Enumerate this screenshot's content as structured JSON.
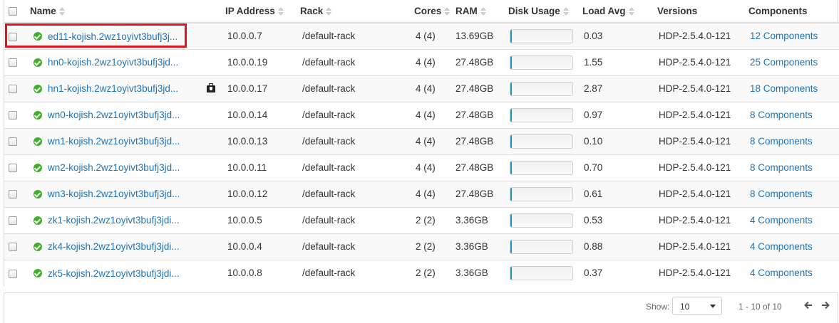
{
  "columns": {
    "name": "Name",
    "ip": "IP Address",
    "rack": "Rack",
    "cores": "Cores",
    "ram": "RAM",
    "disk": "Disk Usage",
    "load": "Load Avg",
    "versions": "Versions",
    "components": "Components"
  },
  "hosts": [
    {
      "name": "ed11-kojish.2wz1oyivt3bufj3j...",
      "ip": "10.0.0.7",
      "rack": "/default-rack",
      "cores": "4 (4)",
      "ram": "13.69GB",
      "disk_fraction": 0.02,
      "load": "0.03",
      "version": "HDP-2.5.4.0-121",
      "components": "12 Components",
      "maintenance": false
    },
    {
      "name": "hn0-kojish.2wz1oyivt3bufj3jd...",
      "ip": "10.0.0.19",
      "rack": "/default-rack",
      "cores": "4 (4)",
      "ram": "27.48GB",
      "disk_fraction": 0.02,
      "load": "1.55",
      "version": "HDP-2.5.4.0-121",
      "components": "25 Components",
      "maintenance": false
    },
    {
      "name": "hn1-kojish.2wz1oyivt3bufj3jd...",
      "ip": "10.0.0.17",
      "rack": "/default-rack",
      "cores": "4 (4)",
      "ram": "27.48GB",
      "disk_fraction": 0.02,
      "load": "2.87",
      "version": "HDP-2.5.4.0-121",
      "components": "18 Components",
      "maintenance": true
    },
    {
      "name": "wn0-kojish.2wz1oyivt3bufj3jd...",
      "ip": "10.0.0.14",
      "rack": "/default-rack",
      "cores": "4 (4)",
      "ram": "27.48GB",
      "disk_fraction": 0.02,
      "load": "0.97",
      "version": "HDP-2.5.4.0-121",
      "components": "8 Components",
      "maintenance": false
    },
    {
      "name": "wn1-kojish.2wz1oyivt3bufj3jd...",
      "ip": "10.0.0.13",
      "rack": "/default-rack",
      "cores": "4 (4)",
      "ram": "27.48GB",
      "disk_fraction": 0.02,
      "load": "0.10",
      "version": "HDP-2.5.4.0-121",
      "components": "8 Components",
      "maintenance": false
    },
    {
      "name": "wn2-kojish.2wz1oyivt3bufj3jd...",
      "ip": "10.0.0.11",
      "rack": "/default-rack",
      "cores": "4 (4)",
      "ram": "27.48GB",
      "disk_fraction": 0.02,
      "load": "0.70",
      "version": "HDP-2.5.4.0-121",
      "components": "8 Components",
      "maintenance": false
    },
    {
      "name": "wn3-kojish.2wz1oyivt3bufj3jd...",
      "ip": "10.0.0.12",
      "rack": "/default-rack",
      "cores": "4 (4)",
      "ram": "27.48GB",
      "disk_fraction": 0.02,
      "load": "0.61",
      "version": "HDP-2.5.4.0-121",
      "components": "8 Components",
      "maintenance": false
    },
    {
      "name": "zk1-kojish.2wz1oyivt3bufj3jdi...",
      "ip": "10.0.0.5",
      "rack": "/default-rack",
      "cores": "2 (2)",
      "ram": "3.36GB",
      "disk_fraction": 0.02,
      "load": "0.53",
      "version": "HDP-2.5.4.0-121",
      "components": "4 Components",
      "maintenance": false
    },
    {
      "name": "zk4-kojish.2wz1oyivt3bufj3jdi...",
      "ip": "10.0.0.4",
      "rack": "/default-rack",
      "cores": "2 (2)",
      "ram": "3.36GB",
      "disk_fraction": 0.02,
      "load": "0.88",
      "version": "HDP-2.5.4.0-121",
      "components": "4 Components",
      "maintenance": false
    },
    {
      "name": "zk5-kojish.2wz1oyivt3bufj3jdi...",
      "ip": "10.0.0.8",
      "rack": "/default-rack",
      "cores": "2 (2)",
      "ram": "3.36GB",
      "disk_fraction": 0.02,
      "load": "0.37",
      "version": "HDP-2.5.4.0-121",
      "components": "4 Components",
      "maintenance": false
    }
  ],
  "footer": {
    "show_label": "Show:",
    "page_size": "10",
    "range": "1 - 10 of 10"
  },
  "colors": {
    "link": "#1f73b7",
    "status_ok": "#3fae2a",
    "disk_fill": "#1f96c8",
    "highlight": "#e0141e"
  },
  "icons": {
    "status": "check-circle-icon",
    "maintenance": "medkit-icon",
    "prev": "arrow-left-icon",
    "next": "arrow-right-icon"
  }
}
